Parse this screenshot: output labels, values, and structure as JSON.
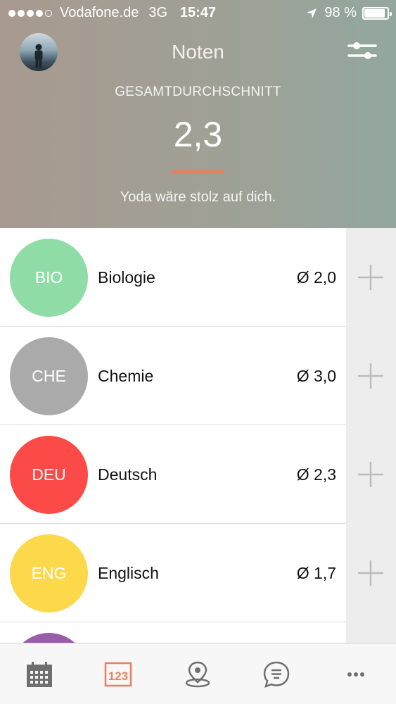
{
  "status_bar": {
    "carrier": "Vodafone.de",
    "network": "3G",
    "time": "15:47",
    "battery": "98 %",
    "battery_level": 0.98
  },
  "header": {
    "title": "Noten",
    "average_label": "GESAMTDURCHSCHNITT",
    "average_value": "2,3",
    "message": "Yoda wäre stolz auf dich.",
    "accent_color": "#ee7d62"
  },
  "subjects": [
    {
      "abbr": "BIO",
      "name": "Biologie",
      "average": "Ø 2,0",
      "color": "#8fdca7"
    },
    {
      "abbr": "CHE",
      "name": "Chemie",
      "average": "Ø 3,0",
      "color": "#aaaaaa"
    },
    {
      "abbr": "DEU",
      "name": "Deutsch",
      "average": "Ø 2,3",
      "color": "#fb4a47"
    },
    {
      "abbr": "ENG",
      "name": "Englisch",
      "average": "Ø 1,7",
      "color": "#fdd84a"
    },
    {
      "abbr": "",
      "name": "",
      "average": "",
      "color": "#9a5ba8"
    }
  ],
  "tab_bar": {
    "active_color": "#ee7d62",
    "inactive_color": "#6f6f6f",
    "tabs": [
      {
        "icon": "calendar-icon",
        "active": false
      },
      {
        "icon": "grades-123-icon",
        "active": true
      },
      {
        "icon": "location-pin-icon",
        "active": false
      },
      {
        "icon": "chat-bubble-icon",
        "active": false
      },
      {
        "icon": "more-icon",
        "active": false
      }
    ]
  }
}
